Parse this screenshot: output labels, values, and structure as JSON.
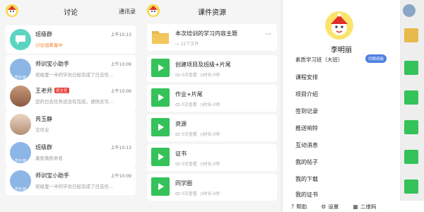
{
  "discussion": {
    "title": "讨论",
    "contacts_label": "通讯录",
    "items": [
      {
        "name": "班级群",
        "sub": "讨论组筹备中",
        "time": "上午10:13"
      },
      {
        "name": "师训宝小助手",
        "sub": "班级里一半的学员已经完成了日志任...",
        "time": "上午10:09",
        "badge_label": "学长/妹"
      },
      {
        "name": "王老师",
        "badge": "班主任",
        "sub": "您的日志任务还没有完成，请快去写...",
        "time": "上午10:09"
      },
      {
        "name": "芮玉静",
        "sub": "交作业",
        "time": ""
      },
      {
        "name": "班级群",
        "sub": "墨鱼微民命名",
        "time": "上午10:13",
        "badge_label": "学长/妹"
      },
      {
        "name": "师训宝小助手",
        "sub": "班级里一半的学员已经完成了日志任...",
        "time": "上午10:09",
        "badge_label": "学长/妹"
      }
    ]
  },
  "resources": {
    "title": "课件资源",
    "items": [
      {
        "name": "本次培训的学习内容主题",
        "meta": "12个文件",
        "type": "folder",
        "more": "···"
      },
      {
        "name": "创建项目及班级+片尾",
        "meta_views": "0次查看",
        "meta_dur": "时长:0秒",
        "type": "video"
      },
      {
        "name": "作业+片尾",
        "meta_views": "0次查看",
        "meta_dur": "时长:0秒",
        "type": "video"
      },
      {
        "name": "资源",
        "meta_views": "0次查看",
        "meta_dur": "时长:0秒",
        "type": "video"
      },
      {
        "name": "证书",
        "meta_views": "0次查看",
        "meta_dur": "时长:0秒",
        "type": "video"
      },
      {
        "name": "同学圈",
        "meta_views": "0次查看",
        "meta_dur": "时长:0秒",
        "type": "video"
      }
    ]
  },
  "profile": {
    "name": "李明丽",
    "class_name": "素质学习班（大班）",
    "switch_label": "切换班级",
    "menu": [
      "课程安排",
      "项目介绍",
      "签到记录",
      "推送响铃",
      "互动消息",
      "我的帖子",
      "我的下载",
      "我的证书"
    ]
  },
  "footer": {
    "help": "帮助",
    "settings": "设置",
    "qrcode": "二维码"
  },
  "colors": {
    "green": "#35c25a",
    "blue": "#4f7fe0",
    "orange": "#f08a3c",
    "red": "#e8403a"
  }
}
